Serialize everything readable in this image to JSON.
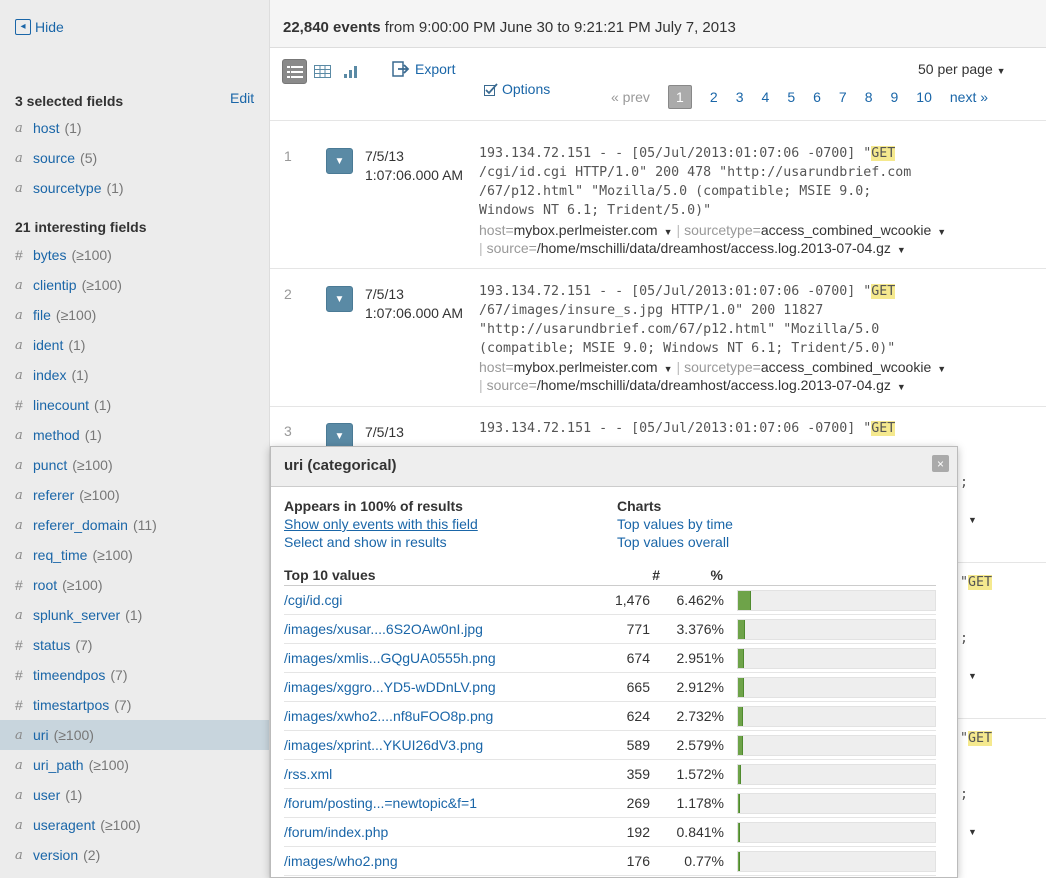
{
  "sidebar": {
    "hide_label": "Hide",
    "selected_heading": "3 selected fields",
    "edit_label": "Edit",
    "interesting_heading": "21 interesting fields",
    "selected_fields": [
      {
        "type": "a",
        "name": "host",
        "count": "(1)"
      },
      {
        "type": "a",
        "name": "source",
        "count": "(5)"
      },
      {
        "type": "a",
        "name": "sourcetype",
        "count": "(1)"
      }
    ],
    "interesting_fields": [
      {
        "type": "#",
        "name": "bytes",
        "count": "(≥100)"
      },
      {
        "type": "a",
        "name": "clientip",
        "count": "(≥100)"
      },
      {
        "type": "a",
        "name": "file",
        "count": "(≥100)"
      },
      {
        "type": "a",
        "name": "ident",
        "count": "(1)"
      },
      {
        "type": "a",
        "name": "index",
        "count": "(1)"
      },
      {
        "type": "#",
        "name": "linecount",
        "count": "(1)"
      },
      {
        "type": "a",
        "name": "method",
        "count": "(1)"
      },
      {
        "type": "a",
        "name": "punct",
        "count": "(≥100)"
      },
      {
        "type": "a",
        "name": "referer",
        "count": "(≥100)"
      },
      {
        "type": "a",
        "name": "referer_domain",
        "count": "(11)"
      },
      {
        "type": "a",
        "name": "req_time",
        "count": "(≥100)"
      },
      {
        "type": "#",
        "name": "root",
        "count": "(≥100)"
      },
      {
        "type": "a",
        "name": "splunk_server",
        "count": "(1)"
      },
      {
        "type": "#",
        "name": "status",
        "count": "(7)"
      },
      {
        "type": "#",
        "name": "timeendpos",
        "count": "(7)"
      },
      {
        "type": "#",
        "name": "timestartpos",
        "count": "(7)"
      },
      {
        "type": "a",
        "name": "uri",
        "count": "(≥100)",
        "selected": true
      },
      {
        "type": "a",
        "name": "uri_path",
        "count": "(≥100)"
      },
      {
        "type": "a",
        "name": "user",
        "count": "(1)"
      },
      {
        "type": "a",
        "name": "useragent",
        "count": "(≥100)"
      },
      {
        "type": "a",
        "name": "version",
        "count": "(2)"
      }
    ]
  },
  "header": {
    "count": "22,840 events",
    "range": " from 9:00:00 PM June 30 to 9:21:21 PM July 7, 2013"
  },
  "toolbar": {
    "export_label": "Export",
    "options_label": "Options",
    "per_page_label": "50 per page",
    "prev_label": "« prev",
    "next_label": "next »",
    "current_page": "1",
    "pages": [
      "2",
      "3",
      "4",
      "5",
      "6",
      "7",
      "8",
      "9",
      "10"
    ]
  },
  "events": [
    {
      "num": "1",
      "date": "7/5/13",
      "time": "1:07:06.000 AM",
      "raw_pre": "193.134.72.151 - - [05/Jul/2013:01:07:06 -0700] \"",
      "raw_hl": "GET",
      "raw_post": "\n/cgi/id.cgi HTTP/1.0\" 200 478 \"http://usarundbrief.com\n/67/p12.html\" \"Mozilla/5.0 (compatible; MSIE 9.0;\nWindows NT 6.1; Trident/5.0)\"",
      "host_key": "host=",
      "host_val": "mybox.perlmeister.com",
      "sourcetype_key": "sourcetype=",
      "sourcetype_val": "access_combined_wcookie",
      "source_key": "source=",
      "source_val": "/home/mschilli/data/dreamhost/access.log.2013-07-04.gz"
    },
    {
      "num": "2",
      "date": "7/5/13",
      "time": "1:07:06.000 AM",
      "raw_pre": "193.134.72.151 - - [05/Jul/2013:01:07:06 -0700] \"",
      "raw_hl": "GET",
      "raw_post": "\n/67/images/insure_s.jpg HTTP/1.0\" 200 11827\n\"http://usarundbrief.com/67/p12.html\" \"Mozilla/5.0\n(compatible; MSIE 9.0; Windows NT 6.1; Trident/5.0)\"",
      "host_key": "host=",
      "host_val": "mybox.perlmeister.com",
      "sourcetype_key": "sourcetype=",
      "sourcetype_val": "access_combined_wcookie",
      "source_key": "source=",
      "source_val": "/home/mschilli/data/dreamhost/access.log.2013-07-04.gz"
    },
    {
      "num": "3",
      "date": "7/5/13",
      "raw_pre": "193.134.72.151 - - [05/Jul/2013:01:07:06 -0700] \"",
      "raw_hl": "GET"
    }
  ],
  "popover": {
    "title": "uri (categorical)",
    "close_label": "×",
    "appears": "Appears in 100% of results",
    "show_only": "Show only events with this field",
    "select_show": "Select and show in results",
    "charts_heading": "Charts",
    "top_by_time": "Top values by time",
    "top_overall": "Top values overall",
    "top10_heading": "Top 10 values",
    "col_count": "#",
    "col_pct": "%",
    "values": [
      {
        "value": "/cgi/id.cgi",
        "count": "1,476",
        "pct": "6.462%",
        "frac": 0.06462
      },
      {
        "value": "/images/xusar....6S2OAw0nI.jpg",
        "count": "771",
        "pct": "3.376%",
        "frac": 0.03376
      },
      {
        "value": "/images/xmlis...GQgUA0555h.png",
        "count": "674",
        "pct": "2.951%",
        "frac": 0.02951
      },
      {
        "value": "/images/xggro...YD5-wDDnLV.png",
        "count": "665",
        "pct": "2.912%",
        "frac": 0.02912
      },
      {
        "value": "/images/xwho2....nf8uFOO8p.png",
        "count": "624",
        "pct": "2.732%",
        "frac": 0.02732
      },
      {
        "value": "/images/xprint...YKUI26dV3.png",
        "count": "589",
        "pct": "2.579%",
        "frac": 0.02579
      },
      {
        "value": "/rss.xml",
        "count": "359",
        "pct": "1.572%",
        "frac": 0.01572
      },
      {
        "value": "/forum/posting...=newtopic&f=1",
        "count": "269",
        "pct": "1.178%",
        "frac": 0.01178
      },
      {
        "value": "/forum/index.php",
        "count": "192",
        "pct": "0.841%",
        "frac": 0.00841
      },
      {
        "value": "/images/who2.png",
        "count": "176",
        "pct": "0.77%",
        "frac": 0.0077
      }
    ]
  },
  "colors": {
    "accent": "#1a66a8",
    "bar_fill": "#6ea349",
    "highlight": "#f5e98e",
    "selected_row": "#c8d5dd"
  },
  "icons": [
    "hide-icon",
    "list-view-icon",
    "table-view-icon",
    "chart-view-icon",
    "export-icon",
    "options-icon",
    "expand-icon",
    "close-icon",
    "chevron-down-icon"
  ]
}
